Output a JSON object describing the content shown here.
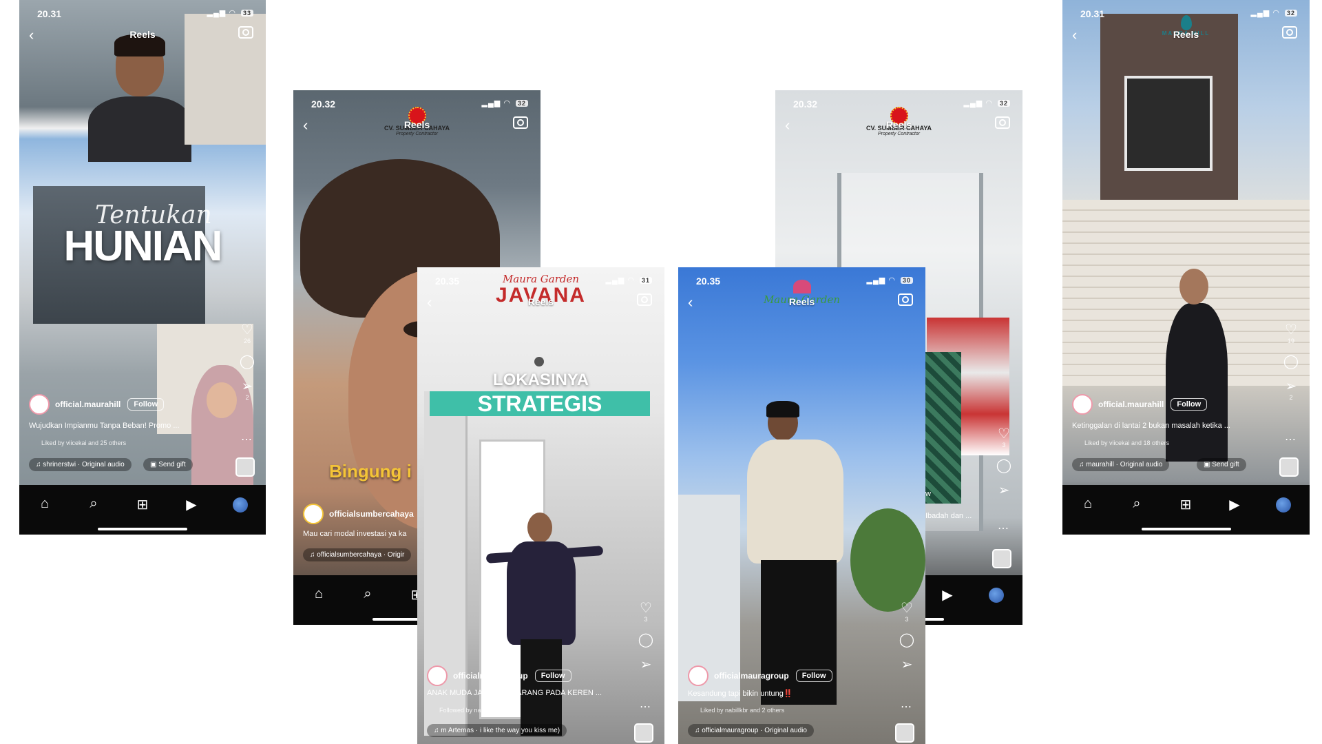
{
  "common": {
    "reels_title": "Reels",
    "send_gift": "Send gift",
    "follow": "Follow",
    "back_glyph": "‹",
    "more_glyph": "⋯",
    "heart_glyph": "♡",
    "comment_glyph": "◯",
    "send_glyph": "➢",
    "note_glyph": "♫",
    "gift_glyph": "▣"
  },
  "phones": [
    {
      "id": "phone1",
      "time": "20.31",
      "battery": "33",
      "overlay_title_script": "Tentukan",
      "overlay_title": "HUNIAN",
      "username": "official.maurahill",
      "caption": "Wujudkan Impianmu Tanpa Beban! Promo ...",
      "liked_by": "Liked by viicekai and 25 others",
      "audio": "shrinerstwi · Original audio",
      "likes": "26",
      "shares": "2"
    },
    {
      "id": "phone2",
      "time": "20.32",
      "battery": "32",
      "brand_logo": "CV. SUMBER CAHAYA",
      "brand_sub": "Property Contractor",
      "overlay_text": "Bingung i",
      "username": "officialsumbercahaya",
      "caption": "Mau cari modal investasi ya ka",
      "audio": "officialsumbercahaya · Origir"
    },
    {
      "id": "phone3",
      "time": "20.35",
      "battery": "31",
      "brand_logo_script": "Maura Garden",
      "brand_logo": "JAVANA",
      "overlay_line1": "LOKASINYA",
      "overlay_line2": "STRATEGIS",
      "username": "officialmauragroup",
      "caption": "ANAK MUDA JAMAN SEKARANG PADA KEREN ...",
      "followed_by": "Followed by nabillkbr",
      "audio": "m Artemas · i like the way you kiss me)",
      "likes": "3"
    },
    {
      "id": "phone4",
      "time": "20.35",
      "battery": "30",
      "brand_logo_script": "Maura Garden",
      "username": "officialmauragroup",
      "caption": "Kesandung tapi bikin untung‼️",
      "liked_by": "Liked by nabillkbr and 2 others",
      "audio": "officialmauragroup · Original audio",
      "likes": "3"
    },
    {
      "id": "phone5",
      "time": "20.32",
      "battery": "32",
      "brand_logo": "CV. SUMBER CAHAYA",
      "brand_sub": "Property Contractor",
      "caption_partial": "Ibadah dan ...",
      "likes": "3",
      "side_text": "w"
    },
    {
      "id": "phone6",
      "time": "20.31",
      "battery": "32",
      "brand_logo": "MAURA HILL",
      "username": "official.maurahill",
      "caption": "Ketinggalan di lantai 2 bukan masalah ketika ...",
      "liked_by": "Liked by viicekai and 18 others",
      "audio": "maurahill · Original audio",
      "likes": "19",
      "shares": "2"
    }
  ],
  "nav": {
    "home_glyph": "⌂",
    "search_glyph": "⌕",
    "add_glyph": "⊞",
    "reels_glyph": "▶",
    "signal_glyph": "▂▄▆",
    "wifi_glyph": "◠"
  }
}
